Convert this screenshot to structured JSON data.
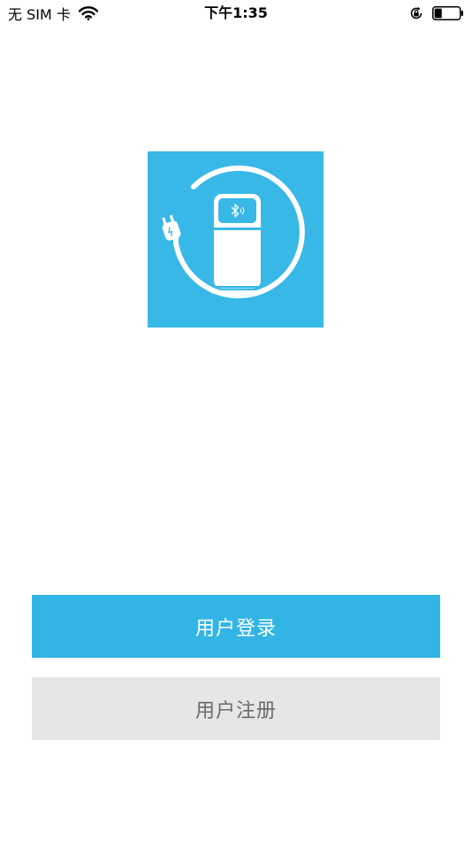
{
  "status_bar": {
    "carrier": "无 SIM 卡",
    "time": "下午1:35",
    "icons": [
      "wifi-icon",
      "orientation-lock-icon",
      "battery-icon"
    ],
    "battery_level": 0.3
  },
  "logo": {
    "icon": "charging-station-bluetooth-logo",
    "background_color": "#38b8e6"
  },
  "actions": {
    "login_label": "用户登录",
    "register_label": "用户注册"
  },
  "colors": {
    "primary": "#32b5e5",
    "secondary_bg": "#e6e6e6",
    "secondary_text": "#6b6b6b"
  }
}
